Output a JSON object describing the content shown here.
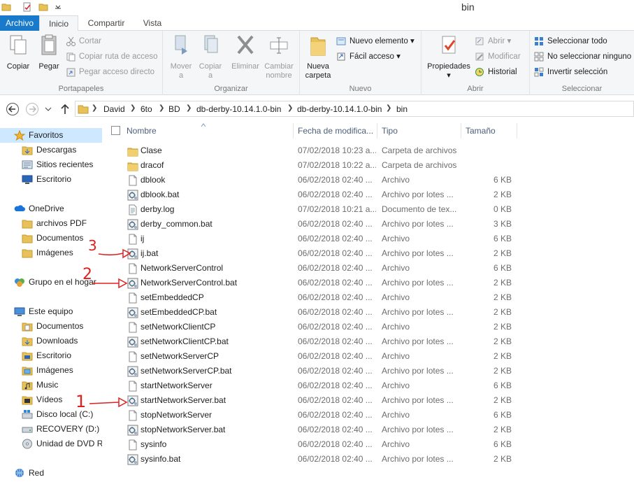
{
  "window": {
    "title": "bin"
  },
  "ribbon_tabs": [
    "Archivo",
    "Inicio",
    "Compartir",
    "Vista"
  ],
  "ribbon": {
    "portapapeles": {
      "label": "Portapapeles",
      "copiar": "Copiar",
      "pegar": "Pegar",
      "cortar": "Cortar",
      "copiar_ruta": "Copiar ruta de acceso",
      "pegar_acceso": "Pegar acceso directo"
    },
    "organizar": {
      "label": "Organizar",
      "mover_a": [
        "Mover",
        "a"
      ],
      "copiar_a": [
        "Copiar",
        "a"
      ],
      "eliminar": "Eliminar",
      "cambiar_nombre": [
        "Cambiar",
        "nombre"
      ]
    },
    "nuevo": {
      "label": "Nuevo",
      "nueva_carpeta": [
        "Nueva",
        "carpeta"
      ],
      "nuevo_elemento": "Nuevo elemento",
      "facil_acceso": "Fácil acceso"
    },
    "abrir": {
      "label": "Abrir",
      "propiedades": "Propiedades",
      "abrir": "Abrir",
      "modificar": "Modificar",
      "historial": "Historial"
    },
    "seleccionar": {
      "label": "Seleccionar",
      "seleccionar_todo": "Seleccionar todo",
      "no_seleccionar": "No seleccionar ninguno",
      "invertir": "Invertir selección"
    }
  },
  "address": {
    "crumbs": [
      "David",
      "6to",
      "BD",
      "db-derby-10.14.1.0-bin",
      "db-derby-10.14.1.0-bin",
      "bin"
    ]
  },
  "nav": {
    "favoritos": "Favoritos",
    "descargas": "Descargas",
    "sitios_recientes": "Sitios recientes",
    "escritorio": "Escritorio",
    "onedrive": "OneDrive",
    "archivos_pdf": "archivos PDF",
    "documentos": "Documentos",
    "imagenes": "Imágenes",
    "grupo_hogar": "Grupo en el hogar",
    "este_equipo": "Este equipo",
    "eq_documentos": "Documentos",
    "eq_downloads": "Downloads",
    "eq_escritorio": "Escritorio",
    "eq_imagenes": "Imágenes",
    "eq_music": "Music",
    "eq_videos": "Vídeos",
    "disco_local": "Disco local (C:)",
    "recovery": "RECOVERY (D:)",
    "dvd": "Unidad de DVD RW",
    "red": "Red"
  },
  "columns": {
    "name": "Nombre",
    "date": "Fecha de modifica...",
    "type": "Tipo",
    "size": "Tamaño"
  },
  "files": [
    {
      "name": "Clase",
      "date": "07/02/2018 10:23 a...",
      "type": "Carpeta de archivos",
      "size": "",
      "icon": "folder"
    },
    {
      "name": "dracof",
      "date": "07/02/2018 10:22 a...",
      "type": "Carpeta de archivos",
      "size": "",
      "icon": "folder"
    },
    {
      "name": "dblook",
      "date": "06/02/2018 02:40 ...",
      "type": "Archivo",
      "size": "6 KB",
      "icon": "file"
    },
    {
      "name": "dblook.bat",
      "date": "06/02/2018 02:40 ...",
      "type": "Archivo por lotes ...",
      "size": "2 KB",
      "icon": "bat"
    },
    {
      "name": "derby.log",
      "date": "07/02/2018 10:21 a...",
      "type": "Documento de tex...",
      "size": "0 KB",
      "icon": "text"
    },
    {
      "name": "derby_common.bat",
      "date": "06/02/2018 02:40 ...",
      "type": "Archivo por lotes ...",
      "size": "3 KB",
      "icon": "bat"
    },
    {
      "name": "ij",
      "date": "06/02/2018 02:40 ...",
      "type": "Archivo",
      "size": "6 KB",
      "icon": "file"
    },
    {
      "name": "ij.bat",
      "date": "06/02/2018 02:40 ...",
      "type": "Archivo por lotes ...",
      "size": "2 KB",
      "icon": "bat"
    },
    {
      "name": "NetworkServerControl",
      "date": "06/02/2018 02:40 ...",
      "type": "Archivo",
      "size": "6 KB",
      "icon": "file"
    },
    {
      "name": "NetworkServerControl.bat",
      "date": "06/02/2018 02:40 ...",
      "type": "Archivo por lotes ...",
      "size": "2 KB",
      "icon": "bat"
    },
    {
      "name": "setEmbeddedCP",
      "date": "06/02/2018 02:40 ...",
      "type": "Archivo",
      "size": "2 KB",
      "icon": "file"
    },
    {
      "name": "setEmbeddedCP.bat",
      "date": "06/02/2018 02:40 ...",
      "type": "Archivo por lotes ...",
      "size": "2 KB",
      "icon": "bat"
    },
    {
      "name": "setNetworkClientCP",
      "date": "06/02/2018 02:40 ...",
      "type": "Archivo",
      "size": "2 KB",
      "icon": "file"
    },
    {
      "name": "setNetworkClientCP.bat",
      "date": "06/02/2018 02:40 ...",
      "type": "Archivo por lotes ...",
      "size": "2 KB",
      "icon": "bat"
    },
    {
      "name": "setNetworkServerCP",
      "date": "06/02/2018 02:40 ...",
      "type": "Archivo",
      "size": "2 KB",
      "icon": "file"
    },
    {
      "name": "setNetworkServerCP.bat",
      "date": "06/02/2018 02:40 ...",
      "type": "Archivo por lotes ...",
      "size": "2 KB",
      "icon": "bat"
    },
    {
      "name": "startNetworkServer",
      "date": "06/02/2018 02:40 ...",
      "type": "Archivo",
      "size": "6 KB",
      "icon": "file"
    },
    {
      "name": "startNetworkServer.bat",
      "date": "06/02/2018 02:40 ...",
      "type": "Archivo por lotes ...",
      "size": "2 KB",
      "icon": "bat"
    },
    {
      "name": "stopNetworkServer",
      "date": "06/02/2018 02:40 ...",
      "type": "Archivo",
      "size": "6 KB",
      "icon": "file"
    },
    {
      "name": "stopNetworkServer.bat",
      "date": "06/02/2018 02:40 ...",
      "type": "Archivo por lotes ...",
      "size": "2 KB",
      "icon": "bat"
    },
    {
      "name": "sysinfo",
      "date": "06/02/2018 02:40 ...",
      "type": "Archivo",
      "size": "6 KB",
      "icon": "file"
    },
    {
      "name": "sysinfo.bat",
      "date": "06/02/2018 02:40 ...",
      "type": "Archivo por lotes ...",
      "size": "2 KB",
      "icon": "bat"
    }
  ],
  "annotations": [
    "3",
    "2",
    "1"
  ],
  "colors": {
    "accent": "#1979ca",
    "folder": "#e8c15a",
    "annotation": "#e0201f"
  }
}
